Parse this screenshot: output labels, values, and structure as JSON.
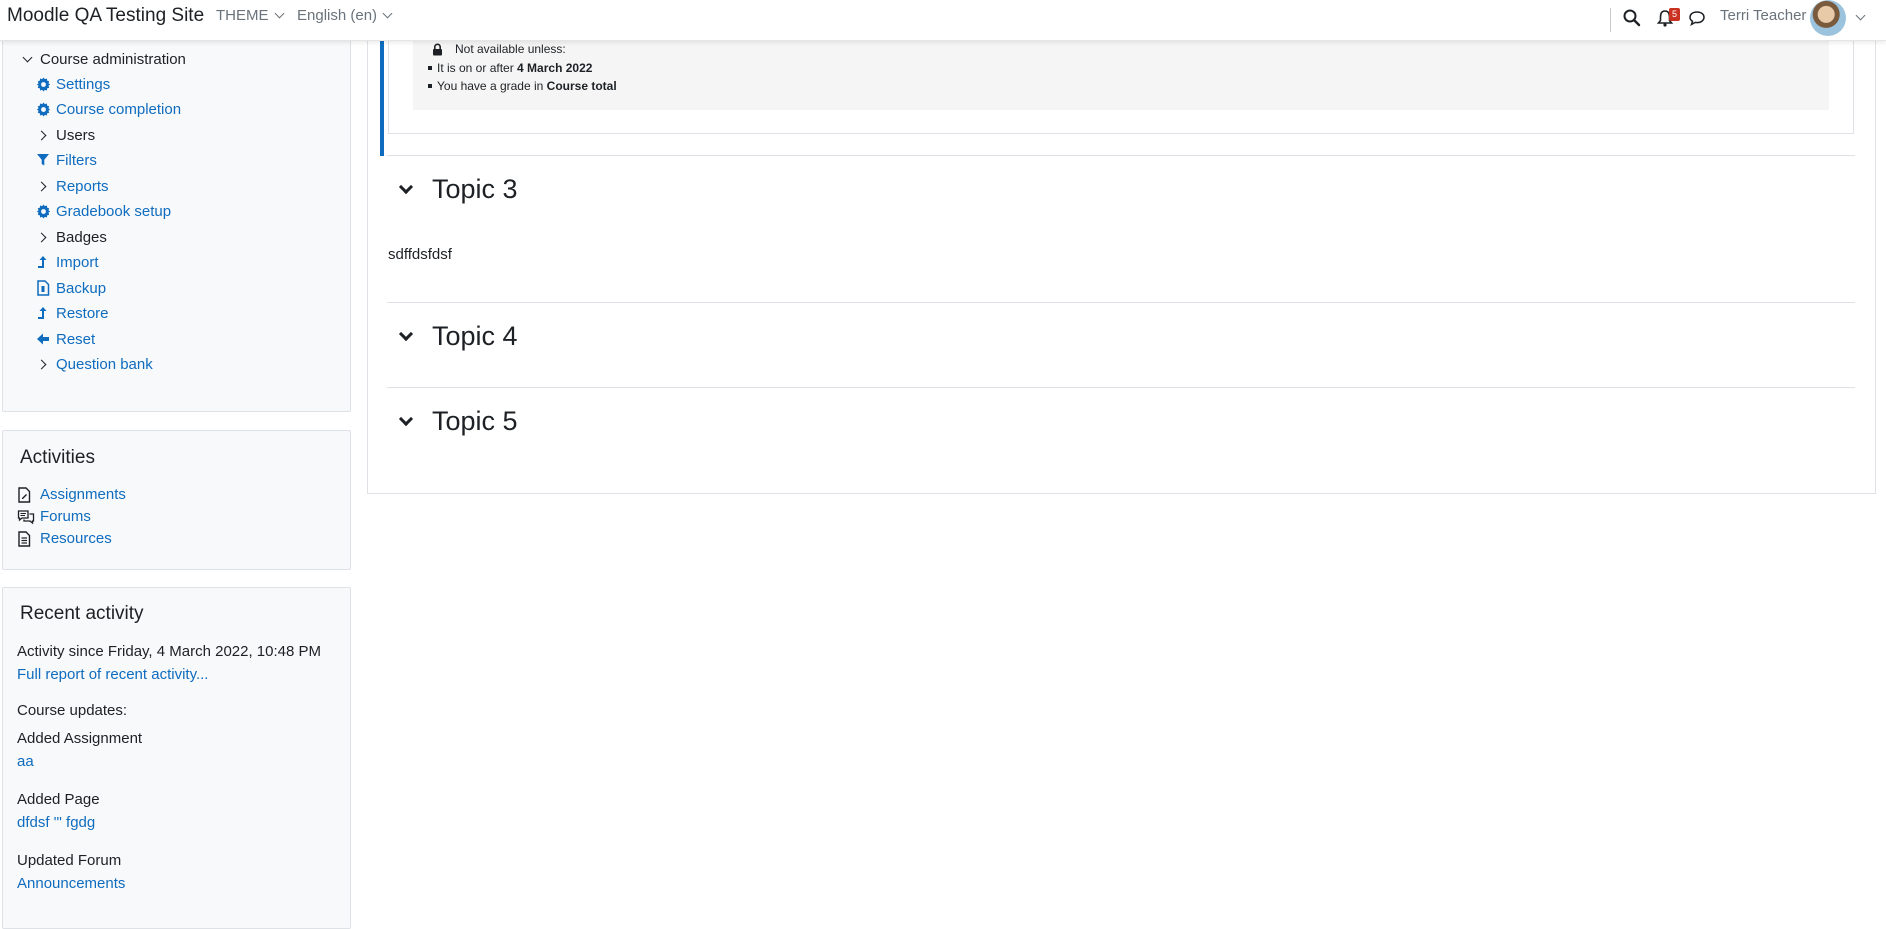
{
  "navbar": {
    "site_name": "Moodle QA Testing Site",
    "theme_menu": "THEME",
    "language_menu": "English (en)",
    "notification_count": "5",
    "user_name": "Terri Teacher"
  },
  "admin_block": {
    "title": "Course administration",
    "items": [
      {
        "label": "Settings",
        "icon": "gear-icon",
        "type": "link"
      },
      {
        "label": "Course completion",
        "icon": "gear-icon",
        "type": "link"
      },
      {
        "label": "Users",
        "icon": "chevron-right-icon",
        "type": "folder"
      },
      {
        "label": "Filters",
        "icon": "filter-icon",
        "type": "link"
      },
      {
        "label": "Reports",
        "icon": "chevron-right-icon",
        "type": "folder-link"
      },
      {
        "label": "Gradebook setup",
        "icon": "gear-icon",
        "type": "link"
      },
      {
        "label": "Badges",
        "icon": "chevron-right-icon",
        "type": "folder"
      },
      {
        "label": "Import",
        "icon": "upload-icon",
        "type": "link"
      },
      {
        "label": "Backup",
        "icon": "backup-file-icon",
        "type": "link"
      },
      {
        "label": "Restore",
        "icon": "upload-icon",
        "type": "link"
      },
      {
        "label": "Reset",
        "icon": "arrow-left-icon",
        "type": "link"
      },
      {
        "label": "Question bank",
        "icon": "chevron-right-icon",
        "type": "folder-link"
      }
    ]
  },
  "activities_block": {
    "title": "Activities",
    "items": [
      {
        "label": "Assignments",
        "icon": "assignment-icon"
      },
      {
        "label": "Forums",
        "icon": "forum-icon"
      },
      {
        "label": "Resources",
        "icon": "resource-icon"
      }
    ]
  },
  "recent_block": {
    "title": "Recent activity",
    "since": "Activity since Friday, 4 March 2022, 10:48 PM",
    "full_report": "Full report of recent activity...",
    "course_updates": "Course updates:",
    "updates": [
      {
        "kind": "Added Assignment",
        "link": "aa"
      },
      {
        "kind": "Added Page",
        "link": "dfdsf '\" fgdg"
      },
      {
        "kind": "Updated Forum",
        "link": "Announcements"
      }
    ]
  },
  "restriction": {
    "header": "Not available unless:",
    "rule1_prefix": "It is on or after ",
    "rule1_value": "4 March 2022",
    "rule2_prefix": "You have a grade in ",
    "rule2_value": "Course total"
  },
  "topics": [
    {
      "title": "Topic 3",
      "summary": "sdffdsfdsf"
    },
    {
      "title": "Topic 4",
      "summary": ""
    },
    {
      "title": "Topic 5",
      "summary": ""
    }
  ],
  "colors": {
    "link": "#0f6cbf",
    "accent_border": "#0f6cbf",
    "badge": "#ca3120"
  }
}
